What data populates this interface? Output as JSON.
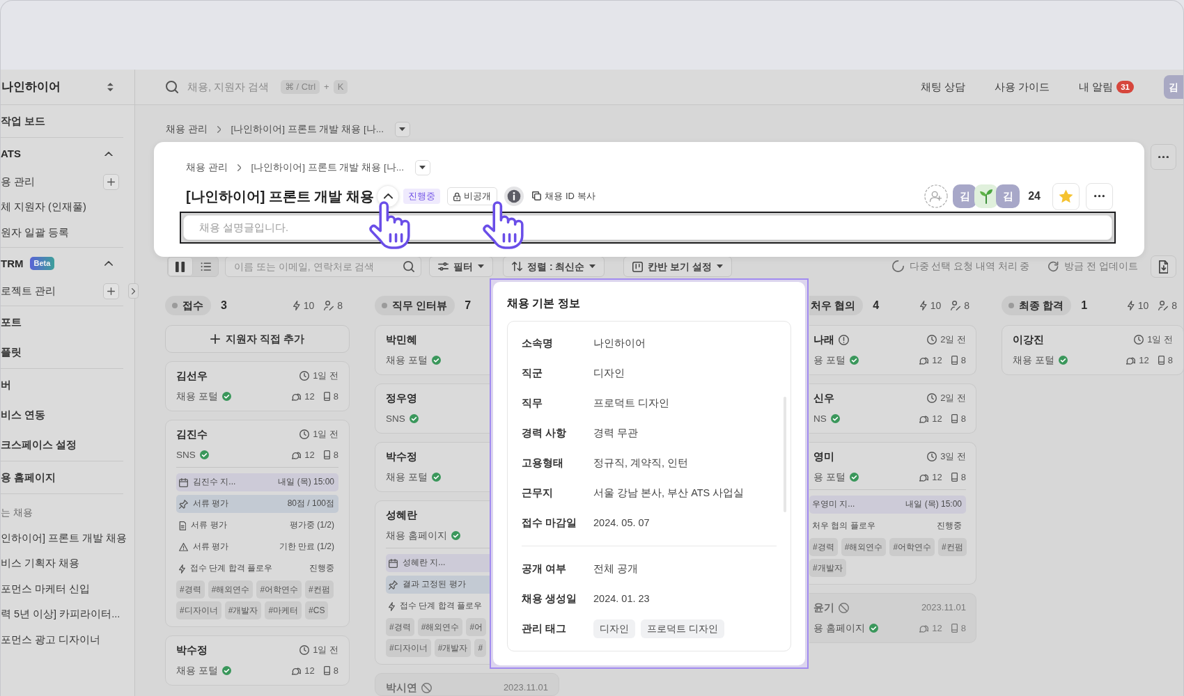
{
  "top_bar": {
    "search": {
      "placeholder": "채용, 지원자 검색",
      "shortcut": [
        "⌘ / Ctrl",
        "K"
      ],
      "joiner": "+"
    },
    "links": [
      "채팅 상담",
      "사용 가이드"
    ],
    "notifications": {
      "label": "내 알림",
      "count": "31"
    },
    "avatar": "김"
  },
  "sidebar": {
    "workspace": "나인하이어",
    "groups": [
      {
        "items": [
          {
            "kind": "page",
            "label": "작업 보드",
            "add_button": false
          }
        ]
      },
      {
        "section": {
          "label": "ATS",
          "expanded": true
        },
        "items": [
          {
            "kind": "sub",
            "label": "용 관리",
            "add_button": true
          },
          {
            "kind": "sub",
            "label": "체 지원자 (인재풀)",
            "add_button": false
          },
          {
            "kind": "sub",
            "label": "원자 일괄 등록",
            "add_button": false
          }
        ]
      },
      {
        "section": {
          "label": "TRM",
          "badge": "Beta",
          "expanded": true
        },
        "items": [
          {
            "kind": "sub",
            "label": "로젝트 관리",
            "add_button": true
          }
        ]
      },
      {
        "items": [
          {
            "kind": "page",
            "label": "포트",
            "add_button": false
          },
          {
            "kind": "page",
            "label": "플릿",
            "add_button": false
          }
        ]
      },
      {
        "items": [
          {
            "kind": "page",
            "label": "버",
            "add_button": false
          },
          {
            "kind": "page",
            "label": "비스 연동",
            "add_button": false
          },
          {
            "kind": "page",
            "label": "크스페이스 설정",
            "add_button": false
          }
        ]
      },
      {
        "items": [
          {
            "kind": "page",
            "label": "용 홈페이지",
            "add_button": false
          }
        ]
      },
      {
        "heading": "는 채용",
        "items": [
          {
            "kind": "recent",
            "label": "인하이어] 프론트 개발 채용",
            "add_button": false
          },
          {
            "kind": "recent",
            "label": "비스 기획자 채용",
            "add_button": false
          },
          {
            "kind": "recent",
            "label": "포먼스 마케터 신입",
            "add_button": false
          },
          {
            "kind": "recent",
            "label": "력 5년 이상] 카피라이터...",
            "add_button": false
          },
          {
            "kind": "recent",
            "label": "포먼스 광고 디자이너",
            "add_button": false
          }
        ]
      }
    ]
  },
  "breadcrumb": [
    "채용 관리",
    "[나인하이어] 프론트 개발 채용 [나..."
  ],
  "job_header": {
    "breadcrumb": [
      "채용 관리",
      "[나인하이어] 프론트 개발 채용 [나..."
    ],
    "title": "[나인하이어] 프론트 개발 채용",
    "expanded": true,
    "status": "진행중",
    "visibility": "비공개",
    "copy_label": "채용 ID 복사",
    "members": [
      {
        "kind": "initial",
        "label": "김"
      },
      {
        "kind": "emoji"
      },
      {
        "kind": "initial",
        "label": "김"
      }
    ],
    "member_count": "24",
    "starred": true,
    "description": {
      "placeholder": "채용 설명글입니다."
    }
  },
  "toolbar": {
    "view_modes": [
      {
        "kind": "board",
        "selected": true
      },
      {
        "kind": "list",
        "selected": false
      }
    ],
    "search": {
      "placeholder": "이름 또는 이메일, 연락처로 검색"
    },
    "filter": "필터",
    "sort": "정렬 : 최신순",
    "view_settings": "칸반 보기 설정",
    "processing": "다중 선택 요청 내역 처리 중",
    "updated": "방금 전 업데이트"
  },
  "columns": [
    {
      "title": "접수",
      "count": "3",
      "automations": "10",
      "assignees": "8",
      "add_label": "지원자 직접 추가",
      "cards": [
        {
          "name": "김선우",
          "alert": false,
          "excluded": false,
          "time": "1일 전",
          "source": "채용 포털",
          "verified": true,
          "chat_count": "12",
          "phone_count": "8"
        },
        {
          "name": "김진수",
          "alert": false,
          "excluded": false,
          "time": "1일 전",
          "source": "SNS",
          "verified": true,
          "chat_count": "12",
          "phone_count": "8",
          "activities": [
            {
              "kind": "schedule",
              "label": "김진수 지...",
              "value": "내일 (목) 15:00"
            },
            {
              "kind": "pinned",
              "label": "서류 평가",
              "value": "80점 / 100점"
            },
            {
              "kind": "document",
              "label": "서류 평가",
              "value": "평가중 (1/2)"
            },
            {
              "kind": "overdue",
              "label": "서류 평가",
              "value": "기한 만료 (1/2)"
            },
            {
              "kind": "flow",
              "label": "접수 단계 합격 플로우",
              "value": "진행중"
            }
          ],
          "tag_rows": [
            [
              "#경력",
              "#해외연수",
              "#어학연수",
              "#컨펌"
            ],
            [
              "#디자이너",
              "#개발자",
              "#마케터",
              "#CS"
            ]
          ]
        },
        {
          "name": "박수정",
          "alert": false,
          "excluded": false,
          "time": "1일 전",
          "source": "채용 포털",
          "verified": true,
          "chat_count": "12",
          "phone_count": "8"
        }
      ]
    },
    {
      "title": "직무 인터뷰",
      "count": "7",
      "cards": [
        {
          "name": "박민혜",
          "alert": false,
          "excluded": false,
          "source": "채용 포털",
          "verified": true
        },
        {
          "name": "정우영",
          "alert": false,
          "excluded": false,
          "source": "SNS",
          "verified": true
        },
        {
          "name": "박수정",
          "alert": false,
          "excluded": false,
          "source": "채용 포털",
          "verified": true
        },
        {
          "name": "성혜란",
          "alert": false,
          "excluded": false,
          "source": "채용 홈페이지",
          "verified": true,
          "activities": [
            {
              "kind": "schedule",
              "label": "성혜란 지..."
            },
            {
              "kind": "pinned",
              "label": "결과 고정된 평가"
            },
            {
              "kind": "flow",
              "label": "접수 단계 합격 플로우"
            }
          ],
          "tag_rows": [
            [
              "#경력",
              "#해외연수",
              "#어"
            ],
            [
              "#디자이너",
              "#개발자",
              "#"
            ]
          ]
        },
        {
          "name": "박시연",
          "alert": false,
          "excluded": true,
          "time": "2023.11.01"
        }
      ]
    },
    {
      "title": "처우 협의",
      "count": "4",
      "automations": "10",
      "assignees": "8",
      "cards": [
        {
          "name": "나래",
          "alert": true,
          "excluded": false,
          "time": "2일 전",
          "source": "용 포털",
          "verified": true,
          "chat_count": "12",
          "phone_count": "8"
        },
        {
          "name": "신우",
          "alert": false,
          "excluded": false,
          "time": "2일 전",
          "source": "NS",
          "verified": true,
          "chat_count": "12",
          "phone_count": "8"
        },
        {
          "name": "영미",
          "alert": false,
          "excluded": false,
          "time": "3일 전",
          "source": "용 포털",
          "verified": true,
          "chat_count": "12",
          "phone_count": "8",
          "activities": [
            {
              "kind": "schedule",
              "label": "우영미 지...",
              "value": "내일 (목) 15:00"
            },
            {
              "kind": "flow",
              "label": "처우 협의 플로우",
              "value": "진행중"
            }
          ],
          "tag_rows": [
            [
              "#경력",
              "#해외연수",
              "#어학연수",
              "#컨펌"
            ],
            [
              "#개발자"
            ]
          ]
        },
        {
          "name": "윤기",
          "alert": false,
          "excluded": true,
          "time": "2023.11.01",
          "source": "용 홈페이지",
          "verified": true,
          "chat_count": "12",
          "phone_count": "8"
        }
      ]
    },
    {
      "title": "최종 합격",
      "count": "1",
      "automations": "10",
      "assignees": "8",
      "cards": [
        {
          "name": "이강진",
          "alert": false,
          "excluded": false,
          "time": "1일 전",
          "source": "채용 포털",
          "verified": true,
          "chat_count": "12",
          "phone_count": "8"
        }
      ]
    }
  ],
  "job_info_popover": {
    "title": "채용 기본 정보",
    "sections": [
      {
        "rows": [
          {
            "label": "소속명",
            "value": "나인하이어"
          },
          {
            "label": "직군",
            "value": "디자인"
          },
          {
            "label": "직무",
            "value": "프로덕트 디자인"
          },
          {
            "label": "경력 사항",
            "value": "경력 무관"
          },
          {
            "label": "고용형태",
            "value": "정규직, 계약직, 인턴"
          },
          {
            "label": "근무지",
            "value": "서울 강남 본사, 부산 ATS 사업실"
          },
          {
            "label": "접수 마감일",
            "value": "2024. 05. 07"
          }
        ]
      },
      {
        "rows": [
          {
            "label": "공개 여부",
            "value": "전체 공개"
          },
          {
            "label": "채용 생성일",
            "value": "2024. 01. 23"
          },
          {
            "label": "관리 태그",
            "tags": [
              "디자인",
              "프로덕트 디자인"
            ]
          }
        ]
      }
    ]
  }
}
